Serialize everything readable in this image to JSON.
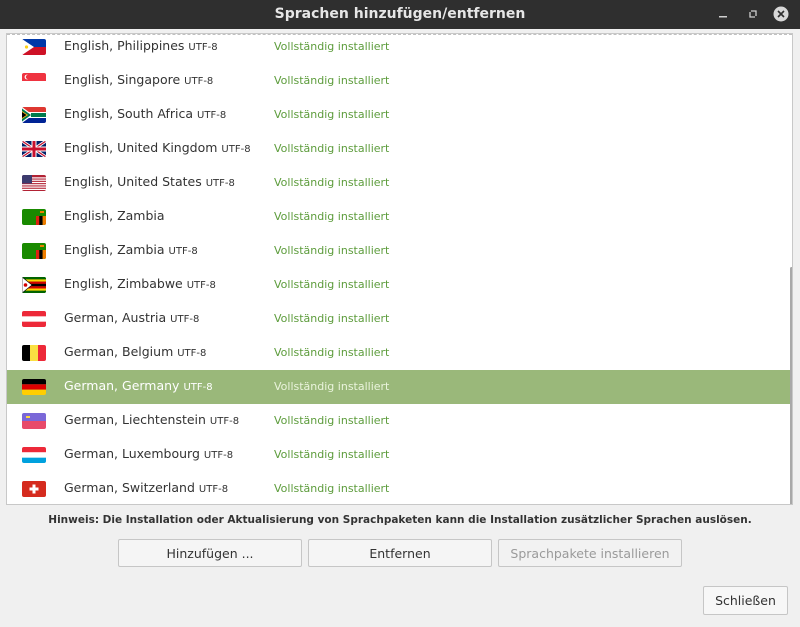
{
  "window": {
    "title": "Sprachen hinzufügen/entfernen"
  },
  "languages": [
    {
      "name": "English, Philippines",
      "encoding": "UTF-8",
      "status": "Vollständig installiert",
      "flag": "flag-philippines"
    },
    {
      "name": "English, Singapore",
      "encoding": "UTF-8",
      "status": "Vollständig installiert",
      "flag": "flag-singapore"
    },
    {
      "name": "English, South Africa",
      "encoding": "UTF-8",
      "status": "Vollständig installiert",
      "flag": "flag-south-africa"
    },
    {
      "name": "English, United Kingdom",
      "encoding": "UTF-8",
      "status": "Vollständig installiert",
      "flag": "flag-united-kingdom"
    },
    {
      "name": "English, United States",
      "encoding": "UTF-8",
      "status": "Vollständig installiert",
      "flag": "flag-united-states"
    },
    {
      "name": "English, Zambia",
      "encoding": "",
      "status": "Vollständig installiert",
      "flag": "flag-zambia"
    },
    {
      "name": "English, Zambia",
      "encoding": "UTF-8",
      "status": "Vollständig installiert",
      "flag": "flag-zambia"
    },
    {
      "name": "English, Zimbabwe",
      "encoding": "UTF-8",
      "status": "Vollständig installiert",
      "flag": "flag-zimbabwe"
    },
    {
      "name": "German, Austria",
      "encoding": "UTF-8",
      "status": "Vollständig installiert",
      "flag": "flag-austria"
    },
    {
      "name": "German, Belgium",
      "encoding": "UTF-8",
      "status": "Vollständig installiert",
      "flag": "flag-belgium"
    },
    {
      "name": "German, Germany",
      "encoding": "UTF-8",
      "status": "Vollständig installiert",
      "flag": "flag-germany",
      "selected": true
    },
    {
      "name": "German, Liechtenstein",
      "encoding": "UTF-8",
      "status": "Vollständig installiert",
      "flag": "flag-liechtenstein"
    },
    {
      "name": "German, Luxembourg",
      "encoding": "UTF-8",
      "status": "Vollständig installiert",
      "flag": "flag-luxembourg"
    },
    {
      "name": "German, Switzerland",
      "encoding": "UTF-8",
      "status": "Vollständig installiert",
      "flag": "flag-switzerland"
    }
  ],
  "hint": "Hinweis: Die Installation oder Aktualisierung von Sprachpaketen kann die Installation zusätzlicher Sprachen auslösen.",
  "buttons": {
    "add": "Hinzufügen ...",
    "remove": "Entfernen",
    "install": "Sprachpakete installieren",
    "close": "Schließen"
  },
  "colors": {
    "selection": "#9ab87a",
    "status_text": "#5d9c3c",
    "titlebar": "#2f2f2f"
  }
}
